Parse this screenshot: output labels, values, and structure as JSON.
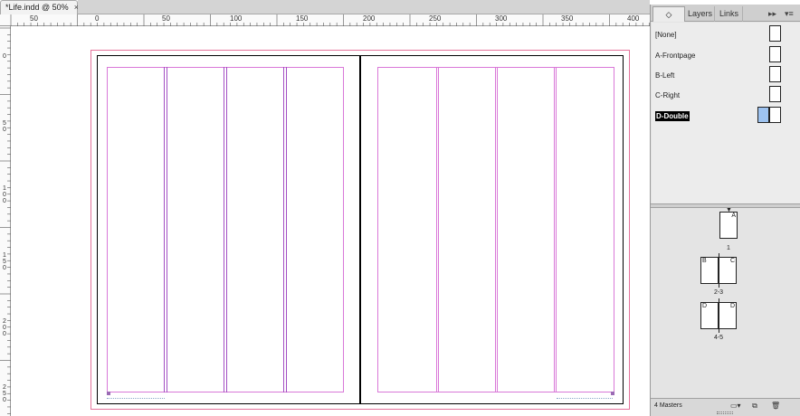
{
  "document": {
    "tab_title": "*Life.indd @ 50%",
    "close_glyph": "×"
  },
  "ruler": {
    "horizontal": [
      "0",
      "50",
      "100",
      "150",
      "200",
      "250",
      "300",
      "350",
      "400"
    ],
    "vertical": [
      "0",
      "5\n0",
      "1\n0\n0",
      "1\n5\n0",
      "2\n0\n0",
      "2\n5\n0"
    ]
  },
  "panel": {
    "tabs": [
      {
        "label": "◇ Pages",
        "active": true
      },
      {
        "label": "Layers",
        "active": false
      },
      {
        "label": "Links",
        "active": false
      }
    ],
    "expand_glyph": "▸▸",
    "menu_glyph": "▾≡",
    "masters": [
      {
        "name": "[None]",
        "type": "single",
        "selected": false
      },
      {
        "name": "A-Frontpage",
        "type": "single",
        "selected": false
      },
      {
        "name": "B-Left",
        "type": "single",
        "selected": false
      },
      {
        "name": "C-Right",
        "type": "single",
        "selected": false
      },
      {
        "name": "D-Double",
        "type": "double",
        "selected": true
      }
    ],
    "pages": [
      {
        "label": "1",
        "masters": [
          "A"
        ]
      },
      {
        "label": "2-3",
        "masters": [
          "B",
          "C"
        ]
      },
      {
        "label": "4-5",
        "masters": [
          "D",
          "D"
        ]
      }
    ],
    "footer": {
      "status": "4 Masters",
      "icons": [
        "edit-page-size-icon",
        "new-page-icon",
        "delete-page-icon"
      ]
    }
  }
}
